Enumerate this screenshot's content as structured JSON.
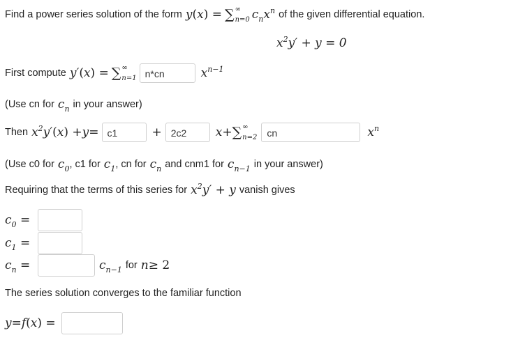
{
  "problem": {
    "prompt_start": "Find a power series solution of the form",
    "prompt_end": "of the given differential equation."
  },
  "step1": {
    "label": "First compute",
    "answer": "n*cn",
    "hint": "(Use cn for",
    "hint_end": "in your answer)"
  },
  "step2": {
    "label": "Then",
    "answer_c1": "c1",
    "answer_2c2": "2c2",
    "answer_sum": "cn",
    "hint_1": "(Use c0 for",
    "hint_2": ", c1 for",
    "hint_3": ", cn for",
    "hint_4": "and cnm1 for",
    "hint_5": "in your answer)"
  },
  "step3": {
    "label": "Requiring that the terms of this series for",
    "label_end": "vanish gives",
    "c0_value": "",
    "c1_value": "",
    "cn_value": "",
    "cn_suffix": "for"
  },
  "step4": {
    "label": "The series solution converges to the familiar function",
    "f_value": ""
  }
}
